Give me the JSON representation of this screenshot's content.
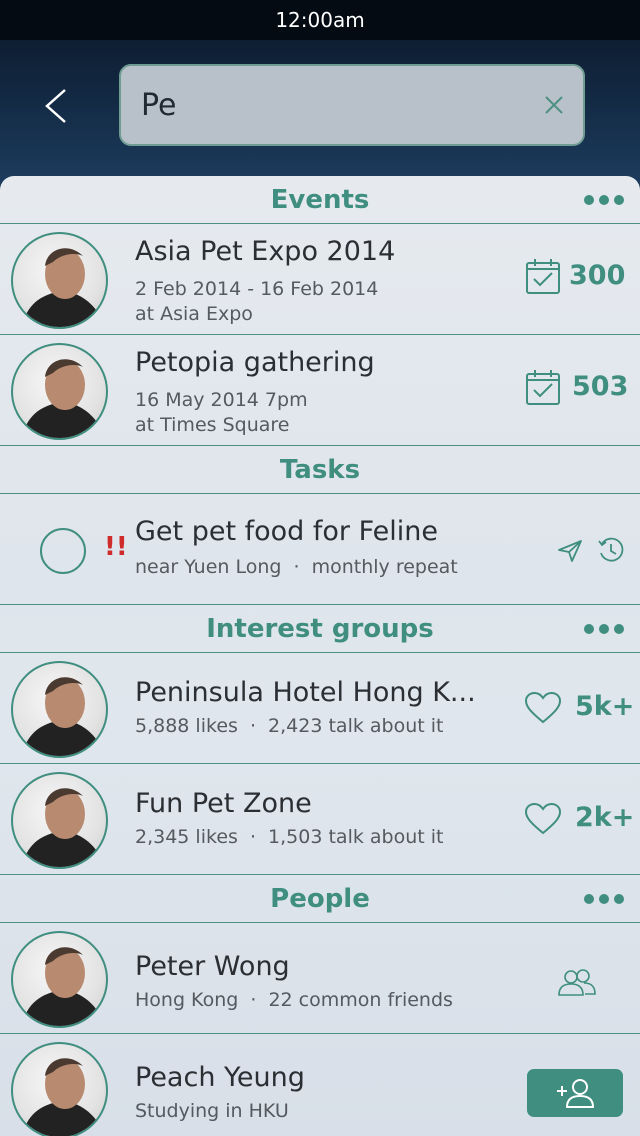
{
  "status_bar": {
    "time": "12:00am"
  },
  "search": {
    "value": "Pe"
  },
  "sections": {
    "events": {
      "title": "Events",
      "items": [
        {
          "title": "Asia Pet Expo 2014",
          "date": "2 Feb 2014 - 16 Feb 2014",
          "location": "at Asia Expo",
          "count": "300"
        },
        {
          "title": "Petopia gathering",
          "date": "16 May 2014 7pm",
          "location": "at Times Square",
          "count": "503"
        }
      ]
    },
    "tasks": {
      "title": "Tasks",
      "items": [
        {
          "title": "Get pet food for Feline",
          "priority": "!!",
          "place": "near Yuen Long",
          "repeat": "monthly repeat"
        }
      ]
    },
    "interest_groups": {
      "title": "Interest groups",
      "items": [
        {
          "title": "Peninsula Hotel Hong K...",
          "likes": "5,888 likes",
          "talk": "2,423 talk about it",
          "count": "5k+"
        },
        {
          "title": "Fun Pet Zone",
          "likes": "2,345 likes",
          "talk": "1,503 talk about it",
          "count": "2k+"
        }
      ]
    },
    "people": {
      "title": "People",
      "items": [
        {
          "name": "Peter Wong",
          "place": "Hong Kong",
          "friends": "22 common friends"
        },
        {
          "name": "Peach Yeung",
          "info": "Studying in HKU"
        }
      ]
    }
  },
  "separator": "·",
  "icons": {
    "back": "chevron-left-icon",
    "clear": "close-icon",
    "more": "more-dots-icon",
    "calendar": "calendar-check-icon",
    "heart": "heart-icon",
    "send": "send-icon",
    "history": "history-icon",
    "friends": "friends-icon",
    "add_friend": "add-friend-icon"
  },
  "colors": {
    "accent": "#3f8e7f",
    "priority": "#cf2b2b",
    "status_bar": "#050b13"
  }
}
